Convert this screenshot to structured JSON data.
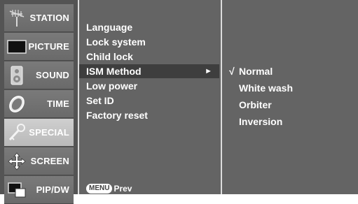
{
  "nav": [
    {
      "label": "STATION",
      "icon": "antenna-icon"
    },
    {
      "label": "PICTURE",
      "icon": "tv-screen-icon"
    },
    {
      "label": "SOUND",
      "icon": "speaker-icon"
    },
    {
      "label": "TIME",
      "icon": "clock-icon"
    },
    {
      "label": "SPECIAL",
      "icon": "key-icon",
      "selected": true
    },
    {
      "label": "SCREEN",
      "icon": "move-arrows-icon"
    },
    {
      "label": "PIP/DW",
      "icon": "pip-windows-icon"
    }
  ],
  "menu": {
    "items": [
      "Language",
      "Lock system",
      "Child lock",
      "ISM Method",
      "Low power",
      "Set ID",
      "Factory reset"
    ],
    "selected_index": 3,
    "arrow": "►",
    "prev_key": "MENU",
    "prev_label": "Prev"
  },
  "options": {
    "items": [
      "Normal",
      "White wash",
      "Orbiter",
      "Inversion"
    ],
    "checked_index": 0,
    "check_mark": "√"
  }
}
